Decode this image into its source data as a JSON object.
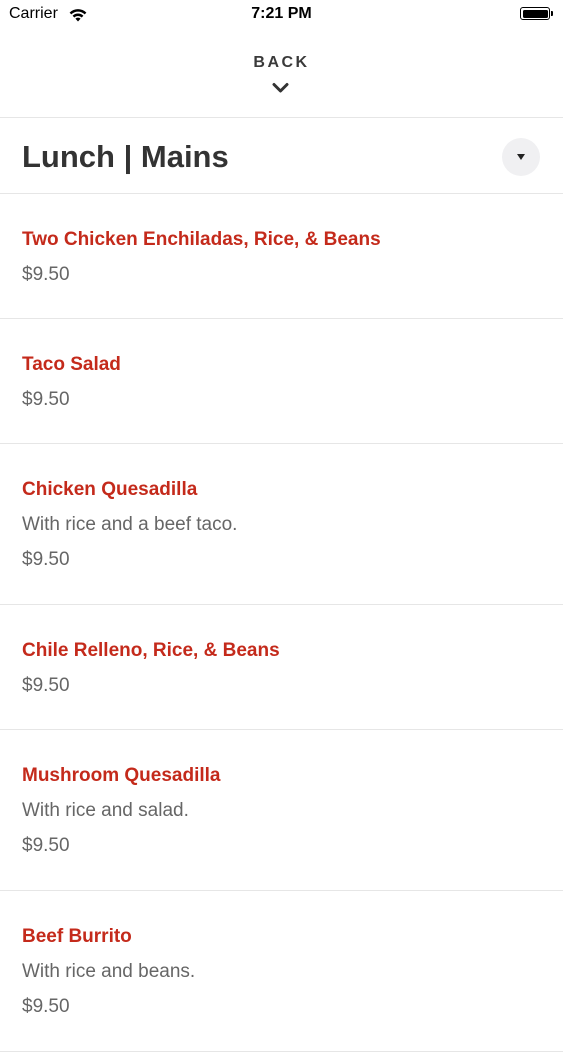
{
  "status_bar": {
    "carrier": "Carrier",
    "time": "7:21 PM"
  },
  "nav": {
    "back_label": "BACK"
  },
  "section": {
    "title": "Lunch | Mains"
  },
  "colors": {
    "item_name": "#c42a1b",
    "text_secondary": "#666666",
    "divider": "#e6e6e6",
    "title": "#333333"
  },
  "menu_items": [
    {
      "name": "Two Chicken Enchiladas, Rice, & Beans",
      "description": "",
      "price": "$9.50"
    },
    {
      "name": "Taco Salad",
      "description": "",
      "price": "$9.50"
    },
    {
      "name": "Chicken Quesadilla",
      "description": "With rice and a beef taco.",
      "price": "$9.50"
    },
    {
      "name": "Chile Relleno, Rice, & Beans",
      "description": "",
      "price": "$9.50"
    },
    {
      "name": "Mushroom Quesadilla",
      "description": "With rice and salad.",
      "price": "$9.50"
    },
    {
      "name": "Beef Burrito",
      "description": "With rice and beans.",
      "price": "$9.50"
    }
  ]
}
